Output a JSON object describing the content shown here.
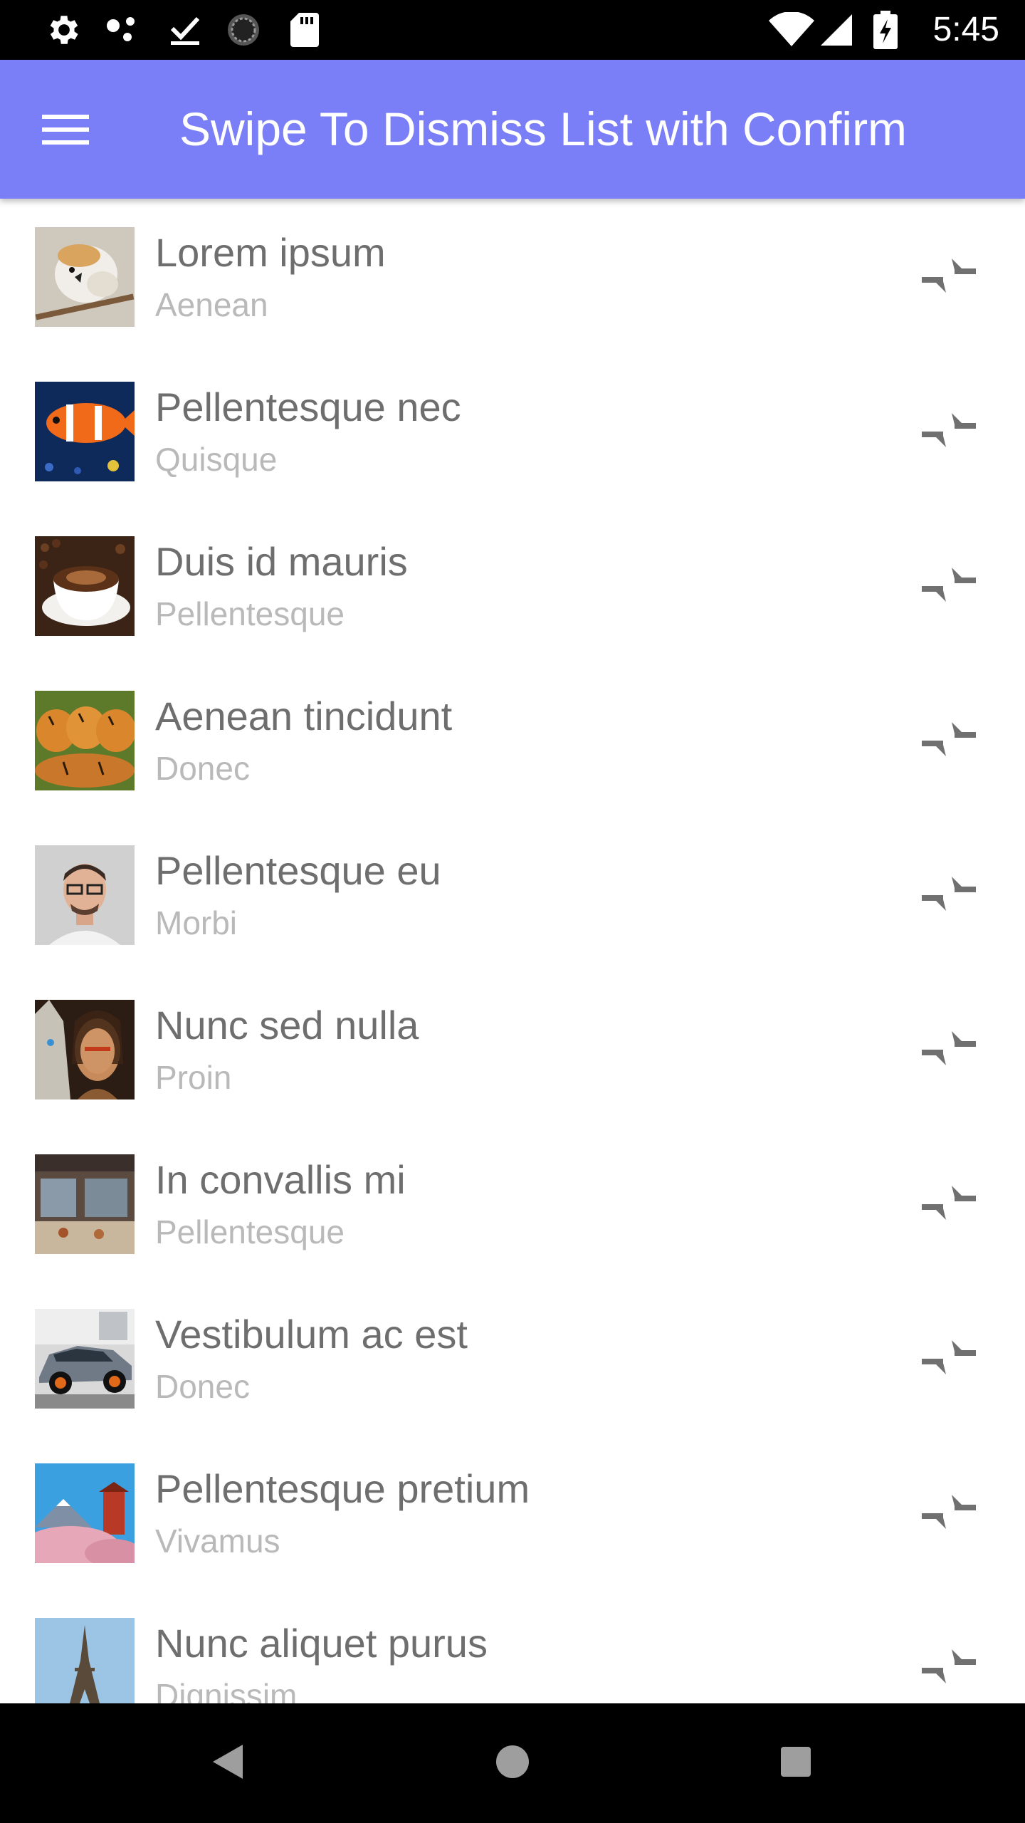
{
  "status_bar": {
    "time": "5:45",
    "left_icons": [
      "settings-icon",
      "dots-icon",
      "download-done-icon",
      "loading-icon",
      "sd-card-icon"
    ],
    "right_icons": [
      "wifi-icon",
      "signal-icon",
      "battery-charging-icon"
    ]
  },
  "app_bar": {
    "title": "Swipe To Dismiss List with Confirm",
    "background": "#7A7EF7",
    "menu_icon": "menu-icon"
  },
  "list": {
    "items": [
      {
        "title": "Lorem ipsum",
        "subtitle": "Aenean",
        "thumb": "bird"
      },
      {
        "title": "Pellentesque nec",
        "subtitle": "Quisque",
        "thumb": "clownfish"
      },
      {
        "title": "Duis id mauris",
        "subtitle": "Pellentesque",
        "thumb": "coffee"
      },
      {
        "title": "Aenean tincidunt",
        "subtitle": "Donec",
        "thumb": "tigers"
      },
      {
        "title": "Pellentesque eu",
        "subtitle": "Morbi",
        "thumb": "man-portrait"
      },
      {
        "title": "Nunc sed nulla",
        "subtitle": "Proin",
        "thumb": "wolf-woman"
      },
      {
        "title": "In convallis mi",
        "subtitle": "Pellentesque",
        "thumb": "cafe-storefront"
      },
      {
        "title": "Vestibulum ac est",
        "subtitle": "Donec",
        "thumb": "car"
      },
      {
        "title": "Pellentesque pretium",
        "subtitle": "Vivamus",
        "thumb": "mount-fuji"
      },
      {
        "title": "Nunc aliquet purus",
        "subtitle": "Dignissim",
        "thumb": "eiffel-tower"
      }
    ],
    "action_icon": "compress-arrows-icon"
  },
  "nav_bar": {
    "buttons": [
      "back-icon",
      "home-icon",
      "recents-icon"
    ]
  }
}
